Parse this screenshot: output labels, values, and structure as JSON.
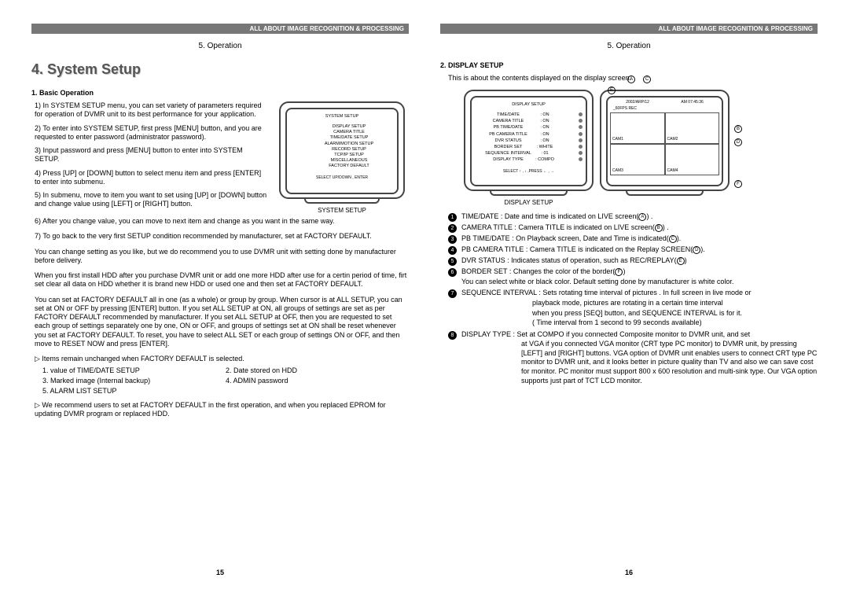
{
  "headerBar": "ALL ABOUT IMAGE RECOGNITION & PROCESSING",
  "chapterLink": "5. Operation",
  "left": {
    "title": "4.  System Setup",
    "subhead": "1. Basic Operation",
    "steps": [
      "1) In SYSTEM SETUP menu, you can set variety of parameters required for operation of DVMR unit to its best performance for your application.",
      "2) To enter into SYSTEM SETUP, first press [MENU] button, and you are requested to enter password (administrator password).",
      "3) Input password and press [MENU] button to enter into SYSTEM SETUP.",
      "4) Press [UP] or [DOWN] button to select menu item and press [ENTER] to enter into submenu.",
      "5) In submenu, move to item you want to set using [UP] or [DOWN] button and change value using [LEFT] or [RIGHT] button.",
      "6) After you change value, you can move to next item and change as you want in the same way.",
      "7) To go back to the very first SETUP condition recommended by manufacturer, set at FACTORY DEFAULT."
    ],
    "para1": "You can change setting as you like, but we do recommend you to use DVMR unit with setting done by manufacturer before delivery.",
    "para2": "When you first install HDD after you purchase DVMR unit or add one more HDD after use for a certin period of time, firt set clear all data on HDD whether it is brand new HDD or used one and then set at FACTORY DEFAULT.",
    "para3": "You can set at FACTORY DEFAULT all in one (as a whole) or group by group. When cursor is at ALL SETUP, you can set at ON or OFF by pressing [ENTER] button. If you set ALL SETUP at ON, all groups of settings are set as per FACTORY DEFAULT recommended by manufacturer. If you set ALL SETUP at OFF, then you are requested to set each group of settings separately one by one, ON or OFF, and groups of settings set at ON shall be reset whenever you set at FACTORY DEFAULT. To reset, you have to select ALL SET or each group of settings ON or OFF, and then move to RESET NOW and press [ENTER].",
    "itemsNote": "▷ Items remain unchanged when FACTORY DEFAULT is selected.",
    "itemsRows": [
      [
        "1. value of TIME/DATE SETUP",
        "2. Date stored on HDD"
      ],
      [
        "3. Marked image (Internal backup)",
        "4. ADMIN password"
      ],
      [
        "5. ALARM LIST SETUP",
        ""
      ]
    ],
    "recommend": "▷ We recommend users to set at FACTORY DEFAULT in the first operation, and when you replaced EPROM for updating DVMR program or replaced HDD.",
    "pageNum": "15",
    "crt": {
      "title": "SYSTEM SETUP",
      "items": [
        "DISPLAY SETUP",
        "CAMERA TITLE",
        "TIME/DATE SETUP",
        "ALARM/MOTION SETUP",
        "RECORD SETUP",
        "TCP/IP SETUP",
        "MISCELLANEOUS",
        "FACTORY DEFAULT"
      ],
      "foot": "SELECT UP/DOWN , ENTER",
      "caption": "SYSTEM SETUP"
    }
  },
  "right": {
    "subhead": "2. DISPLAY SETUP",
    "intro": "This is about the contents displayed on the display screen.",
    "crt1": {
      "title": "DISPLAY SETUP",
      "rows": [
        {
          "k": "TIME/DATE",
          "v": ": ON",
          "n": "1"
        },
        {
          "k": "CAMERA TITLE",
          "v": ": ON",
          "n": "2"
        },
        {
          "k": "PB TIME/DATE",
          "v": ": ON",
          "n": "3"
        },
        {
          "k": "PB CAMERA TITLE",
          "v": ": ON",
          "n": "4"
        },
        {
          "k": "DVR STATUS",
          "v": ": ON",
          "n": "5"
        },
        {
          "k": "BORDER SET",
          "v": ": WHITE",
          "n": "6"
        },
        {
          "k": "SEQUENCE INTERVAL",
          "v": ": 01",
          "n": "7"
        },
        {
          "k": "DISPLAY TYPE",
          "v": ": COMPO",
          "n": "8"
        }
      ],
      "foot": "SELECT ↑ , ↓ ,PRESS   ← , →",
      "caption": "DISPLAY SETUP"
    },
    "crt2": {
      "header": [
        "2002/ARP/12",
        "AM 07:45:36"
      ],
      "sub": "_60FPS   REC",
      "cams": [
        "CAM1",
        "CAM2",
        "CAM3",
        "CAM4"
      ],
      "labels": {
        "A": "A",
        "B": "B",
        "C": "C",
        "D": "D",
        "E": "E",
        "F": "F"
      }
    },
    "numbered": [
      {
        "n": "1",
        "t": "TIME/DATE : Date and time is indicated on LIVE screen(",
        "c": "A",
        "tail": ")     ."
      },
      {
        "n": "2",
        "t": "CAMERA TITLE : Camera TITLE is indicated on LIVE screen(",
        "c": "B",
        "tail": ") ."
      },
      {
        "n": "3",
        "t": "PB TIME/DATE : On Playback screen, Date and Time is indicated(",
        "c": "C",
        "tail": ")."
      },
      {
        "n": "4",
        "t": "PB CAMERA TITLE : Camera TITLE is indicated on the Replay SCREEN(",
        "c": "D",
        "tail": ")."
      },
      {
        "n": "5",
        "t": "DVR STATUS : Indicates status of operation, such as REC/REPLAY(",
        "c": "E",
        "tail": ")"
      },
      {
        "n": "6",
        "t": "BORDER SET : Changes the color of the border(",
        "c": "F",
        "tail": ")"
      },
      {
        "n": "7",
        "t": "SEQUENCE INTERVAL : Sets rotating time interval of pictures . In full screen in live mode or"
      },
      {
        "n": "8",
        "t": "DISPLAY TYPE : Set at COMPO if you connected Composite monitor to DVMR unit, and set"
      }
    ],
    "sixSub": "You can select white or black color. Default setting done by manufacturer is white color.",
    "sevenSubs": [
      "playback mode, pictures are rotating in a certain time interval",
      "when you press [SEQ] button, and SEQUENCE INTERVAL is for it.",
      "( Time interval from 1 second to 99 seconds available)"
    ],
    "eightSub": "at VGA if you connected VGA monitor (CRT type PC monitor) to  DVMR unit, by pressing [LEFT] and [RIGHT] buttons. VGA option of DVMR unit enables users to connect CRT type PC monitor to DVMR unit, and it looks better in picture quality than TV and also we can save cost for monitor. PC monitor must support 800 x 600 resolution and multi-sink type. Our VGA option supports just part of TCT LCD monitor.",
    "pageNum": "16"
  }
}
